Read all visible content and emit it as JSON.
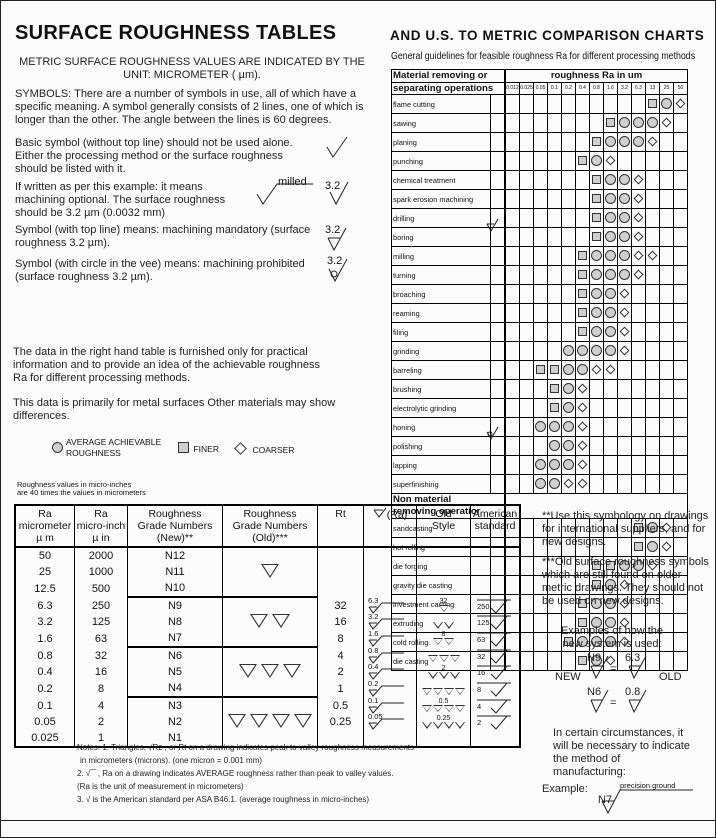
{
  "left": {
    "title": "SURFACE ROUGHNESS TABLES",
    "intro_line1": "METRIC SURFACE ROUGHNESS VALUES ARE INDICATED BY THE",
    "intro_line2": "UNIT: MICROMETER  ( µm).",
    "symbols_para": "SYMBOLS: There are a number of symbols in use, all of which have a specific meaning.  A symbol generally consists of 2 lines, one of which is longer than the other.  The angle between the lines is 60 degrees.",
    "basic_para": "Basic symbol (without top line) should not be used alone. Either the processing method or the surface roughness should be listed with it.",
    "optional_para": "If written as per this example: it means machining optional. The surface roughness should be 3.2  µm (0.0032 mm)",
    "mandatory_para": "Symbol (with top line) means: machining mandatory (surface roughness 3.2  µm).",
    "prohibited_para": "Symbol (with circle in the vee) means: machining prohibited (surface roughness 3.2  µm).",
    "milled_label": "milled",
    "example_value": "3.2",
    "data_para": "The data in the right hand table is furnished only for practical information and to provide an idea of the achievable roughness Ra for different processing methods.",
    "metal_para": "This data is primarily for metal surfaces   Other materials may show differences.",
    "legend": {
      "average": "AVERAGE ACHIEVABLE ROUGHNESS",
      "finer": "FINER",
      "coarser": "COARSER"
    },
    "microinch_note_1": "Roughness values in micro-inches",
    "microinch_note_2": "are 40 times the values in micrometers"
  },
  "chart": {
    "title": "AND U.S. TO METRIC COMPARISON CHARTS",
    "subtitle": "General guidelines for feasible roughness  Ra for different processing methods",
    "header_left_1": "Material removing or",
    "header_left_2": "separating operations",
    "header_right": "roughness Ra  in um",
    "section2_1": "Non material",
    "section2_2": "removing operatior",
    "columns": [
      "0.012",
      "0.025",
      "0.05",
      "0.1",
      "0.2",
      "0.4",
      "0.8",
      "1.6",
      "3.2",
      "6.3",
      "13",
      "25",
      "50"
    ],
    "removing": [
      {
        "name": "flame cutting",
        "finer": [
          10
        ],
        "average": [
          11
        ],
        "coarser": [
          12
        ]
      },
      {
        "name": "sawing",
        "finer": [
          7
        ],
        "average": [
          8,
          9,
          10
        ],
        "coarser": [
          11
        ]
      },
      {
        "name": "planing",
        "finer": [
          6
        ],
        "average": [
          7,
          8,
          9
        ],
        "coarser": [
          10
        ]
      },
      {
        "name": "punching",
        "finer": [
          5
        ],
        "average": [
          6
        ],
        "coarser": [
          7
        ]
      },
      {
        "name": "chemical treatment",
        "finer": [
          6
        ],
        "average": [
          7,
          8
        ],
        "coarser": [
          9
        ]
      },
      {
        "name": "spark erosion machining",
        "finer": [
          6
        ],
        "average": [
          7,
          8
        ],
        "coarser": [
          9
        ]
      },
      {
        "name": "drilling",
        "finer": [
          6
        ],
        "average": [
          7,
          8
        ],
        "coarser": [
          9
        ]
      },
      {
        "name": "boring",
        "finer": [
          6
        ],
        "average": [
          7,
          8
        ],
        "coarser": [
          9
        ]
      },
      {
        "name": "milling",
        "finer": [
          5
        ],
        "average": [
          6,
          7,
          8
        ],
        "coarser": [
          9,
          10
        ]
      },
      {
        "name": "turning",
        "finer": [
          5
        ],
        "average": [
          6,
          7,
          8
        ],
        "coarser": [
          9
        ]
      },
      {
        "name": "broaching",
        "finer": [
          5
        ],
        "average": [
          6,
          7
        ],
        "coarser": [
          8
        ]
      },
      {
        "name": "reaming",
        "finer": [
          5
        ],
        "average": [
          6,
          7
        ],
        "coarser": [
          8
        ]
      },
      {
        "name": "filing",
        "finer": [
          5
        ],
        "average": [
          6,
          7
        ],
        "coarser": [
          8
        ]
      },
      {
        "name": "grinding",
        "finer": [],
        "average": [
          4,
          5,
          6,
          7
        ],
        "coarser": [
          8
        ]
      },
      {
        "name": "barreling",
        "finer": [
          2,
          3
        ],
        "average": [
          4,
          5
        ],
        "coarser": [
          6,
          7
        ]
      },
      {
        "name": "brushing",
        "finer": [
          3
        ],
        "average": [
          4
        ],
        "coarser": [
          5
        ]
      },
      {
        "name": "electrolytic grinding",
        "finer": [
          3
        ],
        "average": [
          4
        ],
        "coarser": [
          5
        ]
      },
      {
        "name": "honing",
        "finer": [],
        "average": [
          2,
          3,
          4
        ],
        "coarser": [
          5
        ]
      },
      {
        "name": "polishing",
        "finer": [],
        "average": [
          3,
          4
        ],
        "coarser": [
          5
        ]
      },
      {
        "name": "lapping",
        "finer": [],
        "average": [
          2,
          3,
          4
        ],
        "coarser": [
          5
        ]
      },
      {
        "name": "superfinishing",
        "finer": [],
        "average": [
          2,
          3
        ],
        "coarser": [
          4,
          5
        ]
      }
    ],
    "non_removing": [
      {
        "name": "sandcasting",
        "finer": [
          9
        ],
        "average": [
          10
        ],
        "coarser": [
          11
        ]
      },
      {
        "name": "hot rolling",
        "finer": [
          9
        ],
        "average": [
          10
        ],
        "coarser": [
          11
        ]
      },
      {
        "name": "die forging",
        "finer": [
          6,
          7
        ],
        "average": [
          8,
          9
        ],
        "coarser": [
          10
        ]
      },
      {
        "name": "gravity die casting",
        "finer": [
          6
        ],
        "average": [
          7
        ],
        "coarser": [
          8
        ]
      },
      {
        "name": "investment casting",
        "finer": [
          5
        ],
        "average": [
          6,
          7
        ],
        "coarser": [
          8
        ]
      },
      {
        "name": "extruding",
        "finer": [
          5
        ],
        "average": [
          6,
          7
        ],
        "coarser": [
          8
        ]
      },
      {
        "name": "cold rolling",
        "finer": [
          4
        ],
        "average": [
          5,
          6,
          7
        ],
        "coarser": [
          8
        ]
      },
      {
        "name": "die casting",
        "finer": [
          5
        ],
        "average": [
          6
        ],
        "coarser": [
          7
        ]
      }
    ]
  },
  "table": {
    "headers": {
      "ra_um": [
        "Ra",
        "micrometer",
        "µ m"
      ],
      "ra_uin": [
        "Ra",
        "micro-inch",
        "µ in"
      ],
      "grade_new": [
        "Roughness",
        "Grade Numbers",
        "(New)**"
      ],
      "grade_old": [
        "Roughness",
        "Grade Numbers",
        "(Old)***"
      ],
      "rt": "Rt",
      "ra_symbol": "(Ra)",
      "old_style": [
        "Old",
        "Style"
      ],
      "american": [
        "American",
        "standard"
      ]
    },
    "rows": [
      {
        "um": "50",
        "uin": "2000",
        "grade": "N12",
        "rt": "",
        "ra_sym": "",
        "old_num": "",
        "old_tri": 0,
        "am": ""
      },
      {
        "um": "25",
        "uin": "1000",
        "grade": "N11",
        "rt": "",
        "ra_sym": "",
        "old_num": "",
        "old_tri": 0,
        "am": ""
      },
      {
        "um": "12.5",
        "uin": "500",
        "grade": "N10",
        "rt": "",
        "ra_sym": "",
        "old_num": "",
        "old_tri": 0,
        "am": ""
      },
      {
        "um": "6.3",
        "uin": "250",
        "grade": "N9",
        "rt": "32",
        "ra_sym": "6.3",
        "old_num": "32",
        "old_tri": 1,
        "am": "250"
      },
      {
        "um": "3.2",
        "uin": "125",
        "grade": "N8",
        "rt": "16",
        "ra_sym": "3.2",
        "old_num": "",
        "old_tri": 2,
        "am": "125"
      },
      {
        "um": "1.6",
        "uin": "63",
        "grade": "N7",
        "rt": "8",
        "ra_sym": "1.6",
        "old_num": "8",
        "old_tri": 2,
        "am": "63"
      },
      {
        "um": "0.8",
        "uin": "32",
        "grade": "N6",
        "rt": "4",
        "ra_sym": "0.8",
        "old_num": "",
        "old_tri": 3,
        "am": "32"
      },
      {
        "um": "0.4",
        "uin": "16",
        "grade": "N5",
        "rt": "2",
        "ra_sym": "0.4",
        "old_num": "2",
        "old_tri": 3,
        "am": "16"
      },
      {
        "um": "0.2",
        "uin": "8",
        "grade": "N4",
        "rt": "1",
        "ra_sym": "0.2",
        "old_num": "",
        "old_tri": 4,
        "am": "8"
      },
      {
        "um": "0.1",
        "uin": "4",
        "grade": "N3",
        "rt": "0.5",
        "ra_sym": "0.1",
        "old_num": "0.5",
        "old_tri": 4,
        "am": "4"
      },
      {
        "um": "0.05",
        "uin": "2",
        "grade": "N2",
        "rt": "0.25",
        "ra_sym": "0.05",
        "old_num": "0.25",
        "old_tri": 4,
        "am": "2"
      },
      {
        "um": "0.025",
        "uin": "1",
        "grade": "N1",
        "rt": "",
        "ra_sym": "",
        "old_num": "",
        "old_tri": 0,
        "am": ""
      }
    ],
    "old_grade_groups": [
      1,
      2,
      3,
      4
    ],
    "notes": [
      "Notes: 1. Triangles,   √Rz  , or Rt  on a drawing indicates peak to valley roughness measurements",
      "in micrometers (microns).  (one micron = 0.001 mm)",
      "2.  √‾‾ , Ra on a drawing indicates AVERAGE roughness rather than peak to valley values.",
      "(Ra is the unit of measurement in micrometers)",
      "3.  √  is the American standard per ASA  B46.1.  (average roughness in micro-inches)"
    ]
  },
  "right": {
    "note_new": "**Use this symbology on drawings for international suppliers, and for new designs.",
    "note_old": "***Old surface roughness symbols which are still found on older metric drawings. They should not be used on new  designs.",
    "examples_title": "Examples of how the new system is used:",
    "new_label": "NEW",
    "old_label": "OLD",
    "ex1_new": "N9",
    "ex1_old": "6.3",
    "ex2_new": "N6",
    "ex2_old": "0.8",
    "equals": "=",
    "method_para": "In certain circumstances, it will be necessary to indicate the method of manufacturing:",
    "example_label": "Example:",
    "example_grade": "N7",
    "example_method": "precision ground"
  }
}
